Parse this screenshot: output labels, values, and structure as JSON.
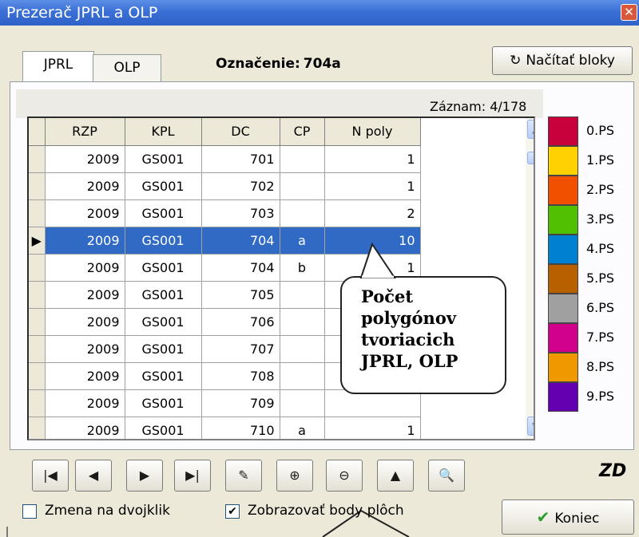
{
  "window": {
    "title": "Prezerač JPRL a OLP",
    "close_icon": "close-icon"
  },
  "tabs": [
    {
      "label": "JPRL",
      "active": true
    },
    {
      "label": "OLP",
      "active": false
    }
  ],
  "header": {
    "oznacenie_label": "Označenie:",
    "oznacenie_value": "704a",
    "load_button": "Načítať bloky",
    "load_icon": "refresh-icon"
  },
  "record": {
    "label": "Záznam:",
    "value": "4/178"
  },
  "grid": {
    "columns": [
      "RZP",
      "KPL",
      "DC",
      "CP",
      "N poly"
    ],
    "rows": [
      [
        "2009",
        "GS001",
        "701",
        "",
        "1"
      ],
      [
        "2009",
        "GS001",
        "702",
        "",
        "1"
      ],
      [
        "2009",
        "GS001",
        "703",
        "",
        "2"
      ],
      [
        "2009",
        "GS001",
        "704",
        "a",
        "10"
      ],
      [
        "2009",
        "GS001",
        "704",
        "b",
        "1"
      ],
      [
        "2009",
        "GS001",
        "705",
        "",
        ""
      ],
      [
        "2009",
        "GS001",
        "706",
        "",
        ""
      ],
      [
        "2009",
        "GS001",
        "707",
        "",
        ""
      ],
      [
        "2009",
        "GS001",
        "708",
        "",
        ""
      ],
      [
        "2009",
        "GS001",
        "709",
        "",
        ""
      ],
      [
        "2009",
        "GS001",
        "710",
        "a",
        "1"
      ]
    ],
    "selected_row": 3,
    "selected_indicator": "▶"
  },
  "legend": [
    {
      "label": "0.PS",
      "color": "#c8003c"
    },
    {
      "label": "1.PS",
      "color": "#ffd200"
    },
    {
      "label": "2.PS",
      "color": "#f05000"
    },
    {
      "label": "3.PS",
      "color": "#50c000"
    },
    {
      "label": "4.PS",
      "color": "#0080d0"
    },
    {
      "label": "5.PS",
      "color": "#b86000"
    },
    {
      "label": "6.PS",
      "color": "#a0a0a0"
    },
    {
      "label": "7.PS",
      "color": "#d0008c"
    },
    {
      "label": "8.PS",
      "color": "#f09800"
    },
    {
      "label": "9.PS",
      "color": "#6400b0"
    }
  ],
  "callout": {
    "lines": [
      "Počet",
      "polygónov",
      "tvoriacich",
      "JPRL, OLP"
    ]
  },
  "toolbar": {
    "buttons": [
      {
        "icon": "first-record-icon",
        "glyph": "|◀"
      },
      {
        "icon": "prev-record-icon",
        "glyph": "◀"
      },
      {
        "icon": "next-record-icon",
        "glyph": "▶"
      },
      {
        "icon": "last-record-icon",
        "glyph": "▶|"
      },
      {
        "icon": "pen-tool-icon",
        "glyph": "✎"
      },
      {
        "icon": "zoom-in-icon",
        "glyph": "⊕"
      },
      {
        "icon": "zoom-out-icon",
        "glyph": "⊖"
      },
      {
        "icon": "extent-icon",
        "glyph": "▲"
      },
      {
        "icon": "search-icon",
        "glyph": "🔍"
      }
    ],
    "logo": "ZD"
  },
  "options": {
    "zmena": {
      "label": "Zmena na dvojklik",
      "checked": false
    },
    "zobrazovat": {
      "label": "Zobrazovať body plôch",
      "checked": true,
      "check_glyph": "✔"
    }
  },
  "koniec": {
    "label": "Koniec",
    "icon": "checkmark-icon",
    "glyph": "✔",
    "color": "#2a9d2a"
  }
}
